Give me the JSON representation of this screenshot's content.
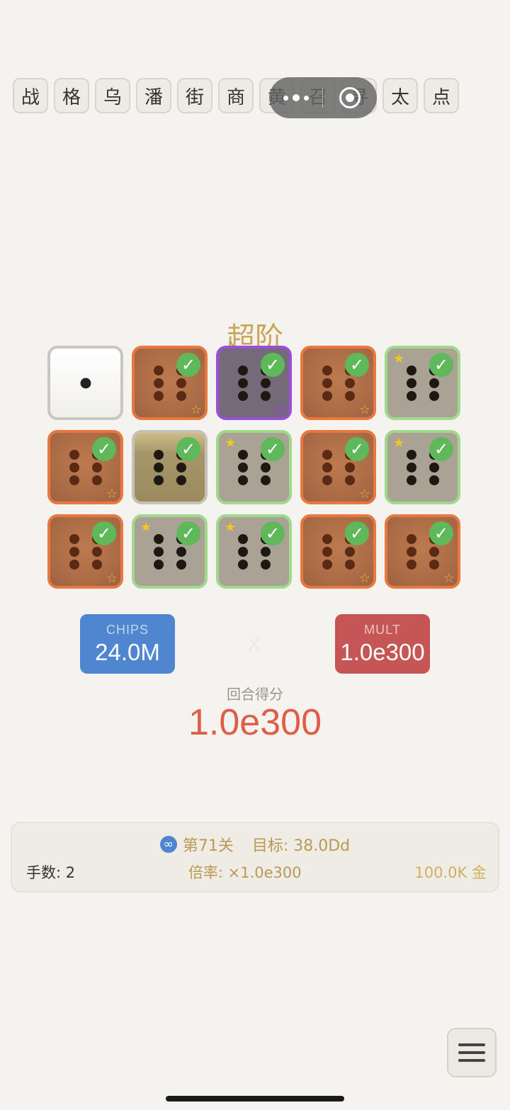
{
  "char_buttons": [
    "战",
    "格",
    "乌",
    "潘",
    "街",
    "商",
    "黄",
    "召",
    "寻",
    "太",
    "点"
  ],
  "hand_name": "超阶",
  "dice": [
    {
      "face": 1,
      "style": "white",
      "selected": false
    },
    {
      "face": 6,
      "style": "orange",
      "selected": true,
      "star_outline": true
    },
    {
      "face": 6,
      "style": "purple",
      "selected": true,
      "tag": "x2"
    },
    {
      "face": 6,
      "style": "orange",
      "selected": true,
      "star_outline": true
    },
    {
      "face": 6,
      "style": "gray",
      "selected": true,
      "star_filled": true
    },
    {
      "face": 6,
      "style": "orange",
      "selected": true,
      "star_outline": true
    },
    {
      "face": 6,
      "style": "olive",
      "selected": true
    },
    {
      "face": 6,
      "style": "gray",
      "selected": true,
      "star_filled": true
    },
    {
      "face": 6,
      "style": "orange",
      "selected": true,
      "star_outline": true
    },
    {
      "face": 6,
      "style": "gray",
      "selected": true,
      "star_filled": true
    },
    {
      "face": 6,
      "style": "orange",
      "selected": true,
      "star_outline": true
    },
    {
      "face": 6,
      "style": "gray",
      "selected": true,
      "star_filled": true
    },
    {
      "face": 6,
      "style": "gray",
      "selected": true,
      "star_filled": true
    },
    {
      "face": 6,
      "style": "orange",
      "selected": true,
      "star_outline": true
    },
    {
      "face": 6,
      "style": "orange",
      "selected": true,
      "star_outline": true
    }
  ],
  "chips": {
    "label": "CHIPS",
    "value": "24.0M"
  },
  "times_symbol": "X",
  "mult": {
    "label": "MULT",
    "value": "1.0e300"
  },
  "round": {
    "label": "回合得分",
    "score": "1.0e300"
  },
  "info": {
    "level": "第71关",
    "target": "目标: 38.0Dd",
    "hands": "手数: 2",
    "rate": "倍率: ×1.0e300",
    "gold": "100.0K 金"
  },
  "icons": {
    "check": "check-icon",
    "star_outline": "star-outline-icon",
    "star_filled": "star-filled-icon",
    "infinity": "infinity-icon",
    "menu": "hamburger-menu-icon"
  },
  "symbols": {
    "check": "✓",
    "star_outline": "☆",
    "star_filled": "★",
    "infinity": "∞"
  },
  "colors": {
    "chips": "#4f86cf",
    "mult": "#c55655",
    "score": "#e05d48",
    "hand_name": "#c9a75a"
  }
}
